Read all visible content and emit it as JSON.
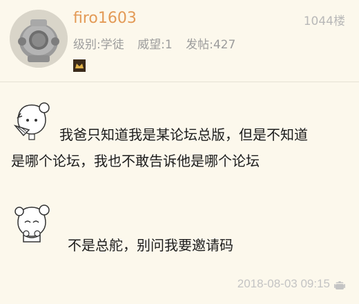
{
  "post": {
    "username": "firo1603",
    "floor": "1044楼",
    "level": "级别:学徒",
    "prestige": "威望:1",
    "posts": "发帖:427",
    "messages": [
      {
        "line1": "我爸只知道我是某论坛总版，但是不知道",
        "line2": "是哪个论坛，我也不敢告诉他是哪个论坛"
      },
      {
        "line1": "不是总舵，别问我要邀请码"
      }
    ],
    "timestamp": "2018-08-03 09:15"
  },
  "colors": {
    "username": "#e39a56",
    "background": "#fcf8ec",
    "meta": "#9c9c9c"
  },
  "icons": [
    "diving-helmet-avatar",
    "rank-badge-icon",
    "sticker-girl-fan",
    "sticker-girl-shy",
    "android-icon"
  ]
}
